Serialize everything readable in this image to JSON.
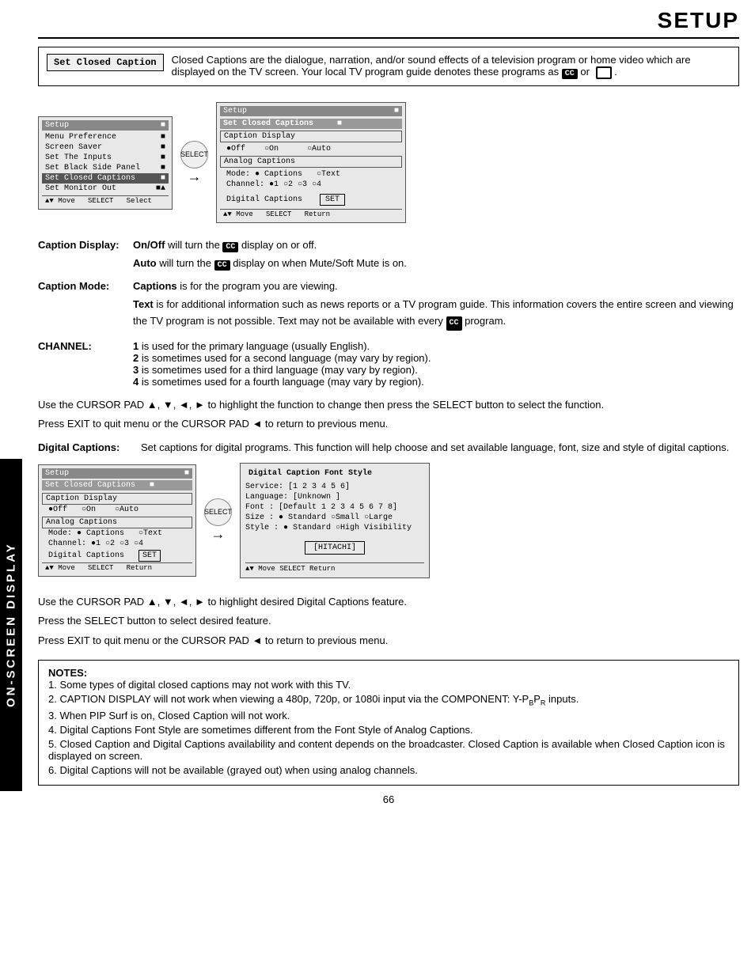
{
  "sidebar": {
    "label": "ON-SCREEN DISPLAY"
  },
  "header": {
    "title": "SETUP"
  },
  "intro": {
    "label": "Set Closed Caption",
    "text": "Closed Captions are the dialogue, narration, and/or sound effects of a television program or home video which are displayed on the TV screen.  Your local TV program guide denotes these programs as",
    "cc_badge": "CC",
    "or_text": "or",
    "end_text": "."
  },
  "menu1": {
    "title": "Setup",
    "items": [
      "Menu Preference",
      "Screen Saver",
      "Set The Inputs",
      "Set Black Side Panel",
      "Set Closed Captions",
      "Set Monitor Out"
    ],
    "selected": "Set Closed Captions",
    "footer": "▲▼ Move  SELECT  Select"
  },
  "arrow_label": "SELECT",
  "menu2": {
    "title": "Setup",
    "subtitle": "Set Closed Captions",
    "caption_display_label": "Caption Display",
    "caption_display_options": [
      "●Off",
      "○On",
      "○Auto"
    ],
    "analog_label": "Analog Captions",
    "analog_mode": "Mode: ● Captions   ○ Text",
    "analog_channel": "Channel: ●1 ○2 ○3 ○4",
    "digital_label": "Digital Captions",
    "set_button": "SET",
    "footer": "▲▼ Move  SELECT Return"
  },
  "body_sections": {
    "caption_display_label": "Caption Display:",
    "caption_display_text": " On/Off will turn the",
    "caption_display_text2": "display on or off.",
    "auto_label": "Auto",
    "auto_text": " will turn the",
    "auto_text2": "display on when Mute/Soft Mute is on.",
    "caption_mode_label": "Caption Mode:",
    "captions_bold": "Captions",
    "captions_text": " is for the program you are viewing.",
    "text_bold": "Text",
    "text_paragraph": " is for additional information such as news reports or a TV program guide.  This information covers the entire screen and viewing the TV program is not possible.  Text may not be available with every",
    "text_end": "program.",
    "channel_label": "CHANNEL:",
    "channel_items": [
      "1 is used for the primary language (usually English).",
      "2 is sometimes used for a second language (may vary by region).",
      "3 is sometimes used for a third language (may vary by region).",
      "4 is sometimes used for a fourth language (may vary by region)."
    ],
    "cursor_text1": "Use the CURSOR PAD ▲, ▼, ◄, ► to highlight the function to change then press the SELECT button to select the function.",
    "cursor_text2": "Press EXIT to quit menu or the CURSOR PAD ◄ to return to previous menu.",
    "digital_bold": "Digital Captions:",
    "digital_text": "Set captions for digital programs.  This function will help choose and set  available language, font, size and style of digital captions."
  },
  "digital_menu": {
    "title": "Setup",
    "subtitle": "Set Closed Captions",
    "caption_display_label": "Caption Display",
    "caption_display_options": [
      "●Off",
      "○On",
      "○Auto"
    ],
    "analog_label": "Analog Captions",
    "analog_mode": "Mode: ● Captions   ○ Text",
    "analog_channel": "Channel: ●1 ○2 ○3 ○4",
    "digital_label": "Digital Captions",
    "set_button": "SET",
    "footer": "▲▼ Move  SELECT Return"
  },
  "digital_font_menu": {
    "title": "Digital Caption Font Style",
    "service": "Service:  [1 2 3 4 5 6]",
    "language": "Language: [Unknown    ]",
    "font": "Font    : [Default 1 2 3 4 5 6 7 8]",
    "size": "Size    : ● Standard  ○Small   ○Large",
    "style": "Style   : ● Standard  ○High Visibility",
    "hitachi_btn": "[HITACHI]",
    "footer": "▲▼ Move  SELECT Return"
  },
  "cursor_digital_text1": "Use the CURSOR PAD ▲, ▼, ◄, ► to highlight desired Digital Captions feature.",
  "cursor_digital_text2": "Press the SELECT button to select desired feature.",
  "cursor_digital_text3": "Press EXIT to quit menu or the CURSOR PAD ◄ to return to previous menu.",
  "notes": {
    "header": "NOTES:",
    "items": [
      "1.  Some types of digital closed captions may not work with this TV.",
      "2.  CAPTION DISPLAY will not work when viewing a 480p, 720p, or 1080i input via the COMPONENT: Y-PBPR inputs.",
      "3.  When PIP Surf is on, Closed Caption will not work.",
      "4.  Digital Captions Font Style are sometimes different from the Font Style of Analog Captions.",
      "5.  Closed Caption and Digital Captions availability and content depends on the broadcaster.  Closed Caption is available when Closed Caption icon is displayed on screen.",
      "6.  Digital Captions will not be available (grayed out) when using analog channels."
    ]
  },
  "page_number": "66"
}
